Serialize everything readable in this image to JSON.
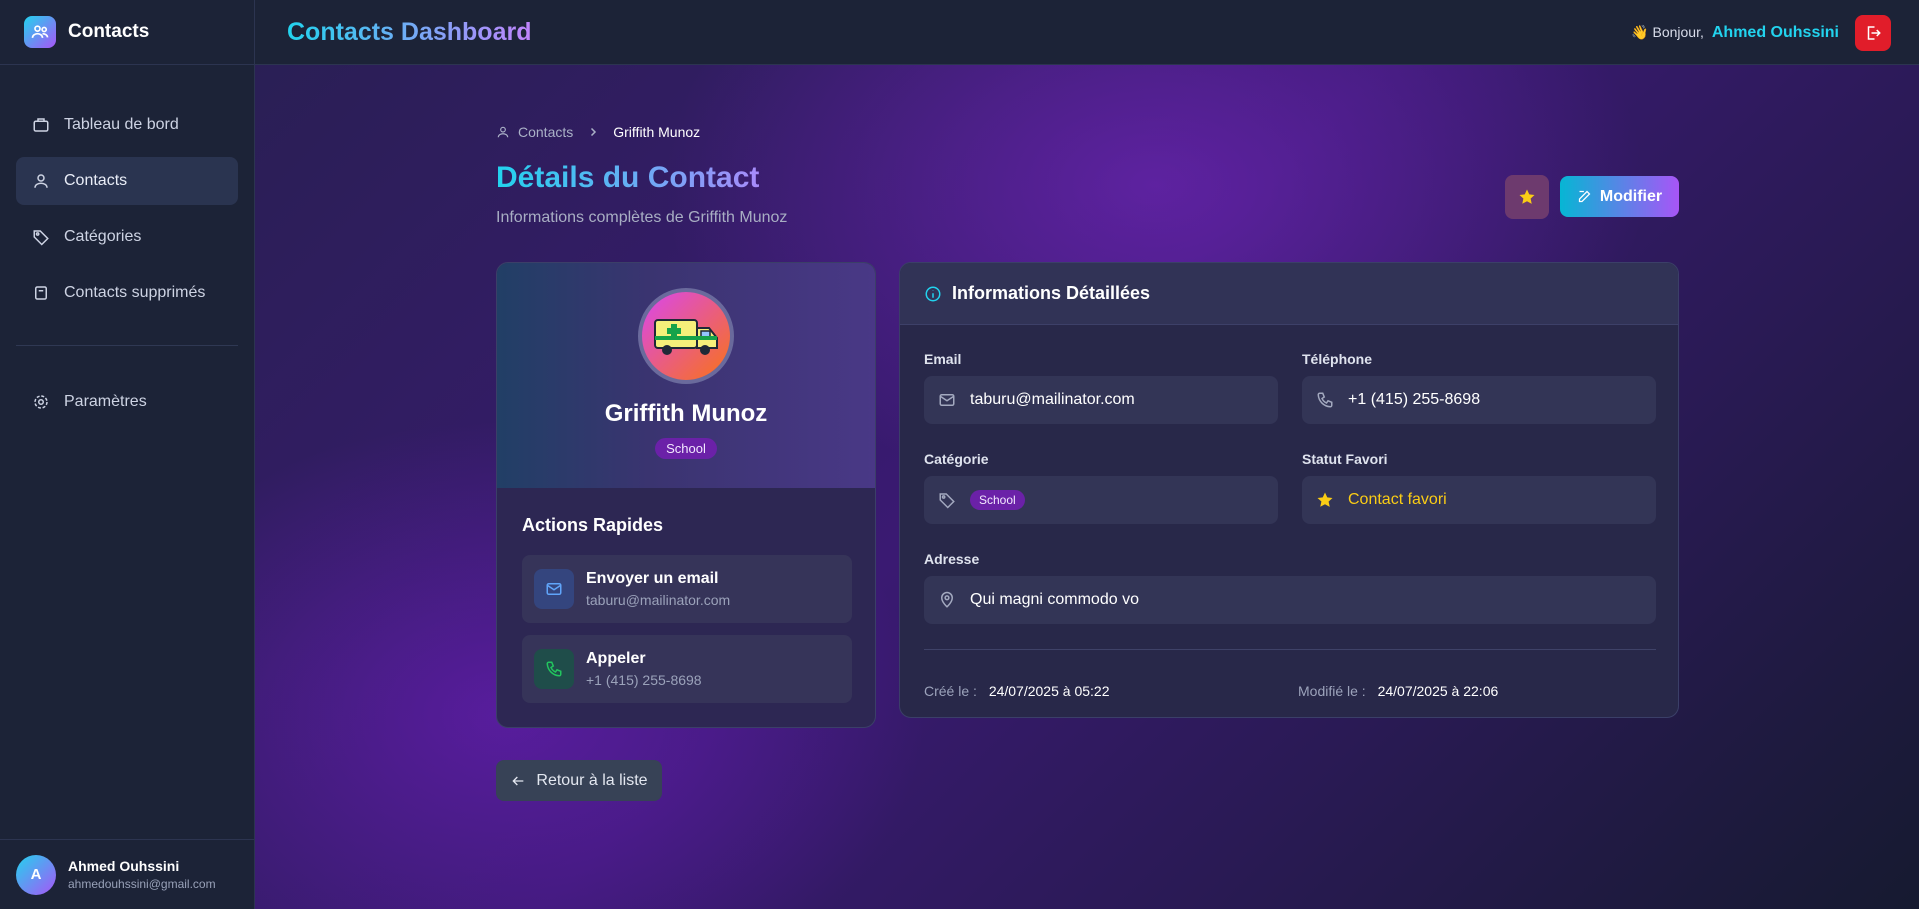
{
  "sidebar": {
    "brand": "Contacts",
    "items": [
      {
        "label": "Tableau de bord",
        "icon": "briefcase-icon"
      },
      {
        "label": "Contacts",
        "icon": "user-icon",
        "active": true
      },
      {
        "label": "Catégories",
        "icon": "tag-icon"
      },
      {
        "label": "Contacts supprimés",
        "icon": "trash-icon"
      },
      {
        "label": "Paramètres",
        "icon": "gear-icon"
      }
    ],
    "user": {
      "initial": "A",
      "name": "Ahmed Ouhssini",
      "email": "ahmedouhssini@gmail.com"
    }
  },
  "header": {
    "title": "Contacts Dashboard",
    "greeting": "👋 Bonjour,",
    "user_name": "Ahmed Ouhssini"
  },
  "breadcrumb": {
    "parent": "Contacts",
    "current": "Griffith Munoz"
  },
  "page": {
    "title": "Détails du Contact",
    "subtitle": "Informations complètes de Griffith Munoz",
    "edit_label": "Modifier"
  },
  "profile": {
    "name": "Griffith Munoz",
    "category": "School",
    "quick_actions_title": "Actions Rapides",
    "actions": [
      {
        "title": "Envoyer un email",
        "sub": "taburu@mailinator.com"
      },
      {
        "title": "Appeler",
        "sub": "+1 (415) 255-8698"
      }
    ]
  },
  "details": {
    "title": "Informations Détaillées",
    "email_label": "Email",
    "email": "taburu@mailinator.com",
    "phone_label": "Téléphone",
    "phone": "+1 (415) 255-8698",
    "category_label": "Catégorie",
    "category": "School",
    "fav_label": "Statut Favori",
    "fav_value": "Contact favori",
    "address_label": "Adresse",
    "address": "Qui magni commodo vo",
    "created_label": "Créé le :",
    "created": "24/07/2025 à 05:22",
    "modified_label": "Modifié le :",
    "modified": "24/07/2025 à 22:06"
  },
  "back_label": "Retour à la liste",
  "colors": {
    "accent": "#22d3ee",
    "purple": "#a855f7",
    "danger": "#e11d2a",
    "favorite": "#facc15"
  }
}
